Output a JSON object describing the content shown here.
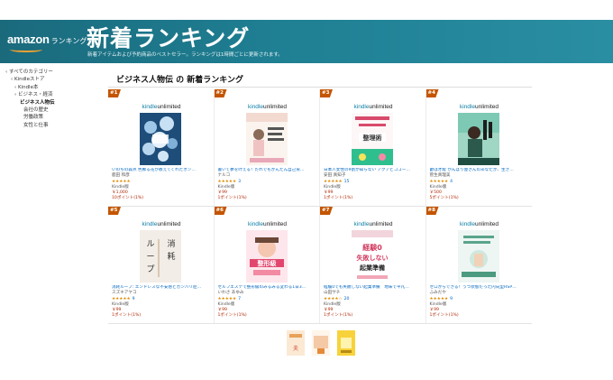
{
  "header": {
    "logo": "amazon",
    "logo_sub": "ランキング",
    "title": "新着ランキング",
    "subtitle": "新着アイテムおよび予約商品のベストセラー。ランキングは1時間ごとに更新されます。"
  },
  "sidebar": {
    "items": [
      {
        "label": "‹ すべてのカテゴリー",
        "level": "lv1"
      },
      {
        "label": "‹ Kindleストア",
        "level": "lv2"
      },
      {
        "label": "‹ Kindle本",
        "level": "lv3"
      },
      {
        "label": "‹ ビジネス・経済",
        "level": "lv3"
      },
      {
        "label": "ビジネス人物伝",
        "level": "cur"
      },
      {
        "label": "会社の歴史",
        "level": "child"
      },
      {
        "label": "労働政策",
        "level": "child"
      },
      {
        "label": "女性と仕事",
        "level": "child"
      }
    ]
  },
  "main": {
    "heading": "ビジネス人物伝 の 新着ランキング"
  },
  "kindle_unlimited": {
    "brand": "kindle",
    "suffix": "unlimited"
  },
  "products": [
    {
      "rank": "#1",
      "title": "いのちの森点 色鮮る花が教えてくれたオン…",
      "author": "鹿田 和彦",
      "stars": "★★★★★",
      "reviews": "",
      "format": "Kindle版",
      "price": "￥1,000",
      "points": "10ポイント(1%)",
      "cover": "blue-flowers"
    },
    {
      "rank": "#2",
      "title": "書いて夢を叶える！だれでもかんたん自己肯…",
      "author": "ナルコ",
      "stars": "★★★★★",
      "reviews": "3",
      "format": "Kindle版",
      "price": "￥99",
      "points": "1ポイント(1%)",
      "cover": "pink-woman"
    },
    {
      "rank": "#3",
      "title": "日本人女性の9割が知らない アクアとココー…",
      "author": "安田 真知子",
      "stars": "★★★★★",
      "reviews": "15",
      "format": "Kindle版",
      "price": "￥99",
      "points": "1ポイント(1%)",
      "cover": "organize"
    },
    {
      "rank": "#4",
      "title": "鬱は才能 がんばり屋さんのあなたが、生き…",
      "author": "菅生真理美",
      "stars": "★★★★★",
      "reviews": "4",
      "format": "Kindle版",
      "price": "￥500",
      "points": "5ポイント(1%)",
      "cover": "green-person"
    },
    {
      "rank": "#5",
      "title": "消耗ループ: エンドレスな不安感とガンバリ症…",
      "author": "スズキアヤコ",
      "stars": "★★★★★",
      "reviews": "9",
      "format": "Kindle版",
      "price": "￥99",
      "points": "1ポイント(1%)",
      "cover": "loop"
    },
    {
      "rank": "#6",
      "title": "セルフエステで整形級のみるみる変わる1日3…",
      "author": "いわさ あゆみ",
      "stars": "★★★★★",
      "reviews": "7",
      "format": "Kindle版",
      "price": "￥99",
      "points": "1ポイント(1%)",
      "cover": "esthetic"
    },
    {
      "rank": "#7",
      "title": "経験0でも失敗しない起業準備　地味で平凡…",
      "author": "山田サチ",
      "stars": "★★★★☆",
      "reviews": "20",
      "format": "Kindle版",
      "price": "￥99",
      "points": "1ポイント(1%)",
      "cover": "kigyou"
    },
    {
      "rank": "#8",
      "title": "ゼロからできる！うつ状態だった内向型HSP…",
      "author": "ふみだや",
      "stars": "★★★★★",
      "reviews": "9",
      "format": "Kindle版",
      "price": "￥99",
      "points": "1ポイント(1%)",
      "cover": "hsp"
    }
  ],
  "extra_covers": [
    "cover-a",
    "cover-b",
    "cover-c"
  ]
}
